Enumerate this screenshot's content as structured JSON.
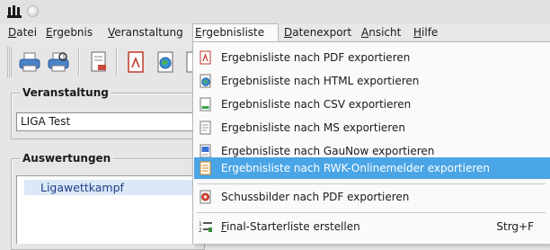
{
  "menubar": {
    "items": [
      {
        "label": "Datei",
        "mnemonic": "D",
        "rest": "atei"
      },
      {
        "label": "Ergebnis",
        "mnemonic": "E",
        "rest": "rgebnis"
      },
      {
        "label": "Veranstaltung",
        "mnemonic": "V",
        "rest": "eranstaltung"
      },
      {
        "label": "Ergebnisliste",
        "mnemonic": "E",
        "rest": "rgebnisliste"
      },
      {
        "label": "Datenexport",
        "mnemonic": "D",
        "rest": "atenexport"
      },
      {
        "label": "Ansicht",
        "mnemonic": "A",
        "rest": "nsicht"
      },
      {
        "label": "Hilfe",
        "mnemonic": "H",
        "rest": "ilfe"
      }
    ]
  },
  "veranstaltung": {
    "title": "Veranstaltung",
    "value": "LIGA Test"
  },
  "auswertungen": {
    "title": "Auswertungen",
    "items": [
      "Ligawettkampf"
    ]
  },
  "dropdown": {
    "items": [
      {
        "label": "Ergebnisliste nach PDF exportieren",
        "icon": "pdf-icon"
      },
      {
        "label": "Ergebnisliste nach HTML exportieren",
        "icon": "html-globe-icon"
      },
      {
        "label": "Ergebnisliste nach CSV exportieren",
        "icon": "csv-icon"
      },
      {
        "label": "Ergebnisliste nach MS exportieren",
        "icon": "ms-document-icon"
      },
      {
        "label": "Ergebnisliste nach GauNow exportieren",
        "icon": "gaunow-icon"
      },
      {
        "label": "Ergebnisliste nach RWK-Onlinemelder exportieren",
        "icon": "rwk-document-icon",
        "highlighted": true
      }
    ],
    "extra_item": {
      "label": "Schussbilder nach PDF exportieren",
      "icon": "target-pdf-icon"
    },
    "final_item": {
      "mnemonic": "F",
      "rest": "inal-Starterliste erstellen",
      "shortcut": "Strg+F",
      "icon": "starter-list-icon"
    }
  },
  "colors": {
    "highlight": "#4aa5e6",
    "background": "#e6e6e6",
    "menu_background": "#fafafa",
    "selected_list_item": "#dbe8f6"
  }
}
